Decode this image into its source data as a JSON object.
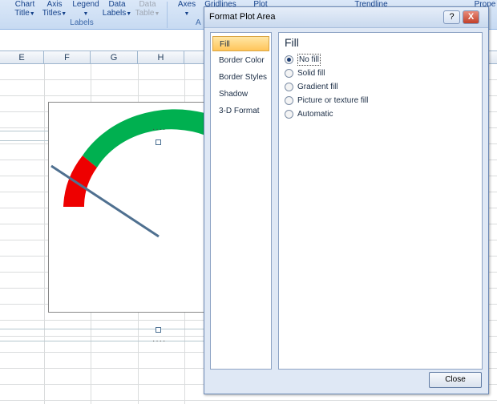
{
  "ribbon": {
    "buttons": [
      {
        "line1": "Chart",
        "line2": "Title",
        "disabled": false
      },
      {
        "line1": "Axis",
        "line2": "Titles",
        "disabled": false
      },
      {
        "line1": "Legend",
        "line2": "",
        "disabled": false
      },
      {
        "line1": "Data",
        "line2": "Labels",
        "disabled": false
      },
      {
        "line1": "Data",
        "line2": "Table",
        "disabled": true
      },
      {
        "line1": "Axes",
        "line2": "",
        "disabled": false
      },
      {
        "line1": "Gridlines",
        "line2": "",
        "disabled": false
      },
      {
        "line1": "Plot",
        "line2": "",
        "disabled": false
      },
      {
        "line1": "Trendline",
        "line2": "",
        "disabled": false
      },
      {
        "line1": "Prope",
        "line2": "",
        "disabled": false
      }
    ],
    "group_labels": "Labels",
    "group_axes": "A"
  },
  "sheet": {
    "columns": [
      "E",
      "F",
      "G",
      "H"
    ]
  },
  "chart": {
    "gauge_colors": {
      "red": "#ee0000",
      "green": "#00b050",
      "needle": "#4f7090"
    }
  },
  "dialog": {
    "title": "Format Plot Area",
    "help_label": "?",
    "close_x": "X",
    "nav_items": [
      "Fill",
      "Border Color",
      "Border Styles",
      "Shadow",
      "3-D Format"
    ],
    "selected_nav": "Fill",
    "heading": "Fill",
    "options": [
      {
        "label": "No fill",
        "checked": true
      },
      {
        "label": "Solid fill",
        "checked": false
      },
      {
        "label": "Gradient fill",
        "checked": false
      },
      {
        "label": "Picture or texture fill",
        "checked": false
      },
      {
        "label": "Automatic",
        "checked": false
      }
    ],
    "close_button": "Close"
  }
}
